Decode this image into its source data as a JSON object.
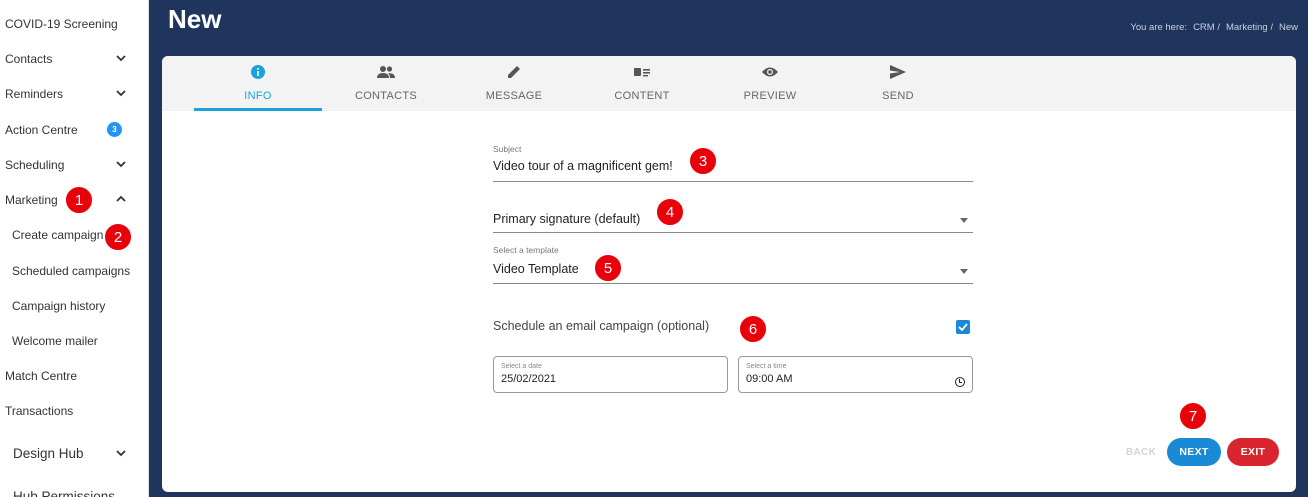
{
  "sidebar": {
    "items": [
      {
        "label": "COVID-19 Screening"
      },
      {
        "label": "Contacts"
      },
      {
        "label": "Reminders"
      },
      {
        "label": "Action Centre",
        "badge": "3"
      },
      {
        "label": "Scheduling"
      },
      {
        "label": "Marketing"
      },
      {
        "label": "Create campaign"
      },
      {
        "label": "Scheduled campaigns"
      },
      {
        "label": "Campaign history"
      },
      {
        "label": "Welcome mailer"
      },
      {
        "label": "Match Centre"
      },
      {
        "label": "Transactions"
      },
      {
        "label": "Design Hub"
      },
      {
        "label": "Hub Permissions"
      }
    ]
  },
  "header": {
    "title": "New",
    "breadcrumb": {
      "prefix": "You are here:",
      "items": [
        "CRM /",
        "Marketing /",
        "New"
      ]
    }
  },
  "tabs": [
    {
      "label": "INFO",
      "icon": "info-icon",
      "active": true
    },
    {
      "label": "CONTACTS",
      "icon": "people-icon"
    },
    {
      "label": "MESSAGE",
      "icon": "pencil-icon"
    },
    {
      "label": "CONTENT",
      "icon": "content-icon"
    },
    {
      "label": "PREVIEW",
      "icon": "eye-icon"
    },
    {
      "label": "SEND",
      "icon": "send-icon"
    }
  ],
  "form": {
    "subject_label": "Subject",
    "subject_value": "Video tour of a magnificent gem!",
    "signature_value": "Primary signature (default)",
    "template_label": "Select a template",
    "template_value": "Video Template",
    "schedule_label": "Schedule an email campaign (optional)",
    "schedule_checked": true,
    "date_label": "Select a date",
    "date_value": "25/02/2021",
    "time_label": "Select a time",
    "time_value": "09:00 AM"
  },
  "actions": {
    "back": "BACK",
    "next": "NEXT",
    "exit": "EXIT"
  },
  "markers": [
    "1",
    "2",
    "3",
    "4",
    "5",
    "6",
    "7"
  ],
  "colors": {
    "header_bg": "#1f355e",
    "accent": "#1aa3d9",
    "next": "#1a8ad6",
    "exit": "#d9252f",
    "marker": "#e8000b"
  }
}
